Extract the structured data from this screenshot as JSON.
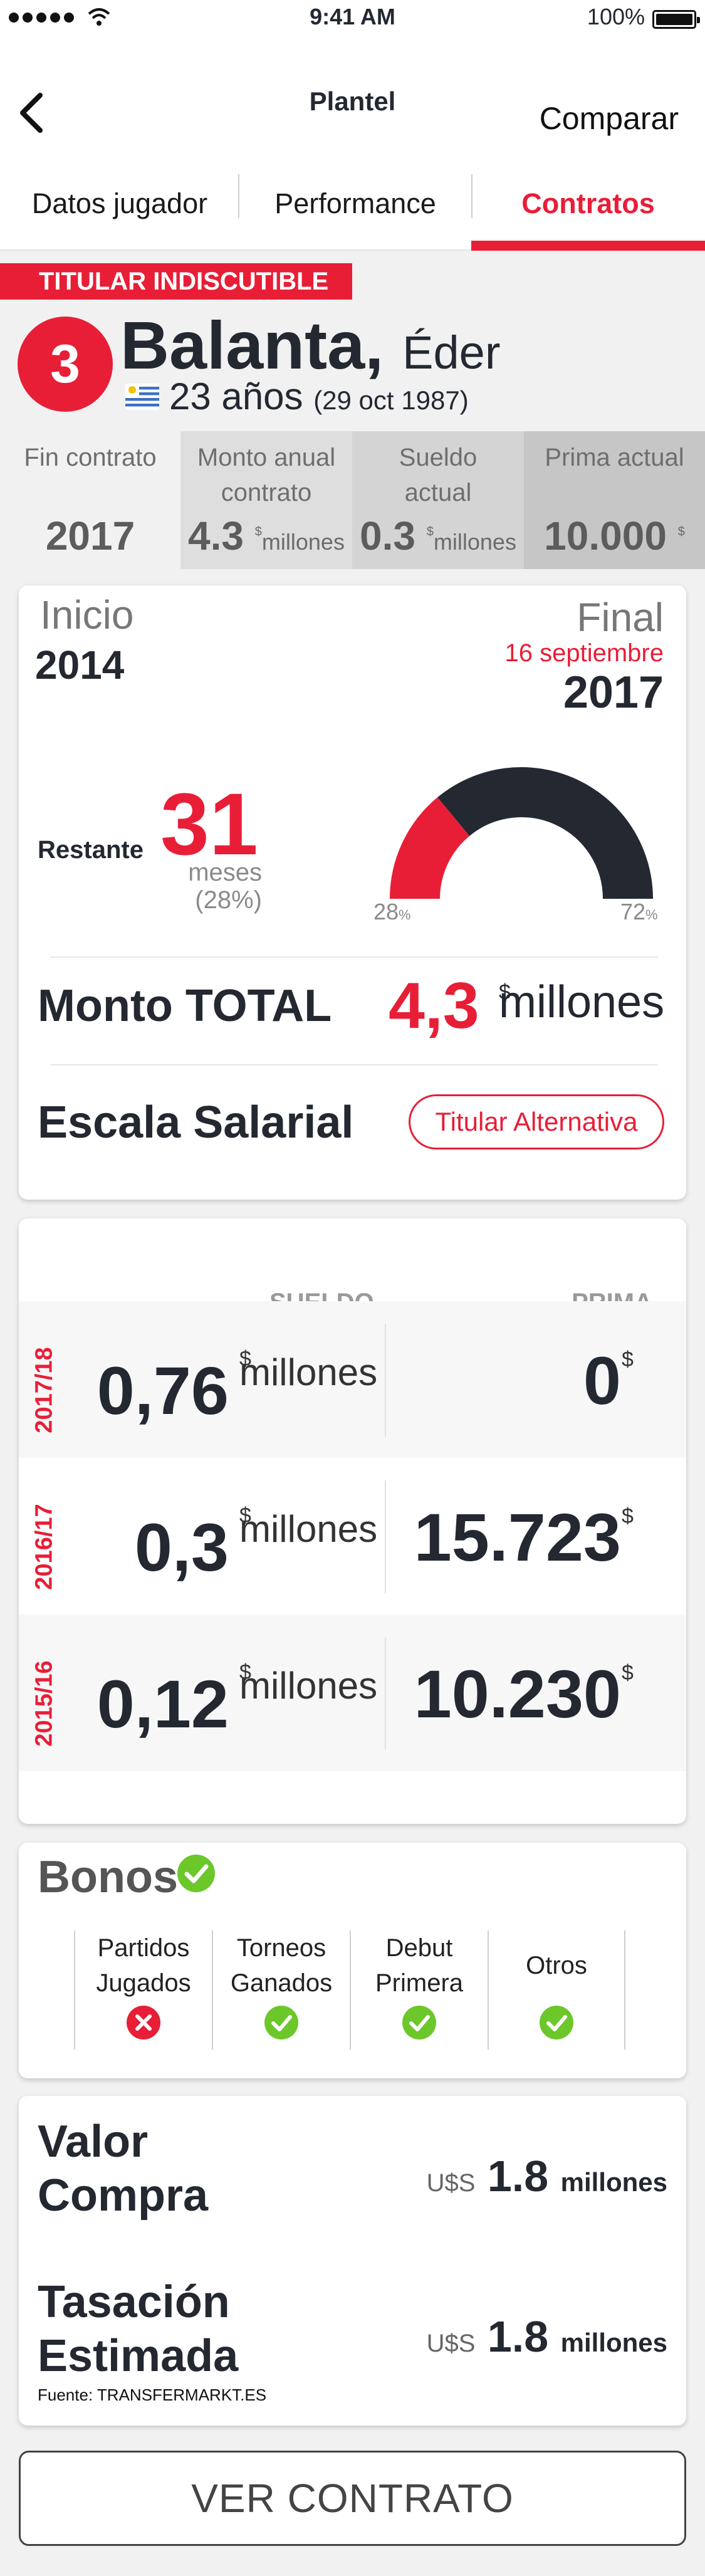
{
  "status_bar": {
    "time": "9:41 AM",
    "battery": "100%"
  },
  "nav": {
    "title": "Plantel",
    "compare_label": "Comparar"
  },
  "tabs": [
    "Datos jugador",
    "Performance",
    "Contratos"
  ],
  "player": {
    "badge": "TITULAR INDISCUTIBLE",
    "number": "3",
    "surname": "Balanta,",
    "first_name": "Éder",
    "age": "23 años",
    "birth": "(29 oct 1987)"
  },
  "stats": [
    {
      "label": "Fin contrato",
      "value": "2017",
      "unit": "",
      "currency": ""
    },
    {
      "label": "Monto anual contrato",
      "value": "4.3",
      "unit": "millones",
      "currency": "$"
    },
    {
      "label": "Sueldo actual",
      "value": "0.3",
      "unit": "millones",
      "currency": "$"
    },
    {
      "label": "Prima actual",
      "value": "10.000",
      "unit": "",
      "currency": "$"
    }
  ],
  "contract": {
    "inicio_label": "Inicio",
    "inicio_year": "2014",
    "final_label": "Final",
    "final_date": "16 septiembre",
    "final_year": "2017",
    "restante_label": "Restante",
    "restante_value": "31",
    "restante_unit": "meses",
    "restante_pct": "(28%)",
    "gauge": {
      "elapsed_fraction": 0.28,
      "remaining_fraction": 0.72,
      "lo_label": "28",
      "hi_label": "72",
      "pct_sign": "%",
      "elapsed_color": "#e81e37",
      "remaining_color": "#232831"
    },
    "monto_label": "Monto TOTAL",
    "monto_value": "4,3",
    "monto_currency": "$",
    "monto_unit": "millones",
    "escala_label": "Escala Salarial",
    "escala_value": "Titular Alternativa"
  },
  "salary": {
    "col_sueldo": "SUELDO",
    "col_prima": "PRIMA",
    "rows": [
      {
        "season": "2017/18",
        "sueldo": "0,76",
        "sueldo_currency": "$",
        "sueldo_unit": "millones",
        "prima": "0",
        "prima_currency": "$"
      },
      {
        "season": "2016/17",
        "sueldo": "0,3",
        "sueldo_currency": "$",
        "sueldo_unit": "millones",
        "prima": "15.723",
        "prima_currency": "$"
      },
      {
        "season": "2015/16",
        "sueldo": "0,12",
        "sueldo_currency": "$",
        "sueldo_unit": "millones",
        "prima": "10.230",
        "prima_currency": "$"
      }
    ]
  },
  "bonos": {
    "title": "Bonos",
    "title_icon": "check-circle-icon",
    "items": [
      {
        "label": "Partidos Jugados",
        "icon": "x-circle-icon",
        "status": "no"
      },
      {
        "label": "Torneos Ganados",
        "icon": "check-circle-icon",
        "status": "yes"
      },
      {
        "label": "Debut Primera",
        "icon": "check-circle-icon",
        "status": "yes"
      },
      {
        "label": "Otros",
        "icon": "check-circle-icon",
        "status": "yes"
      }
    ]
  },
  "valor": {
    "compra_label": "Valor Compra",
    "compra_currency": "U$S",
    "compra_value": "1.8",
    "compra_unit": "millones",
    "tasacion_label": "Tasación Estimada",
    "tasacion_currency": "U$S",
    "tasacion_value": "1.8",
    "tasacion_unit": "millones",
    "source": "Fuente: TRANSFERMARKT.ES"
  },
  "cta": {
    "label": "VER CONTRATO"
  },
  "colors": {
    "accent": "#e81e37",
    "dark": "#232831",
    "ok_green": "#6cc72b"
  }
}
